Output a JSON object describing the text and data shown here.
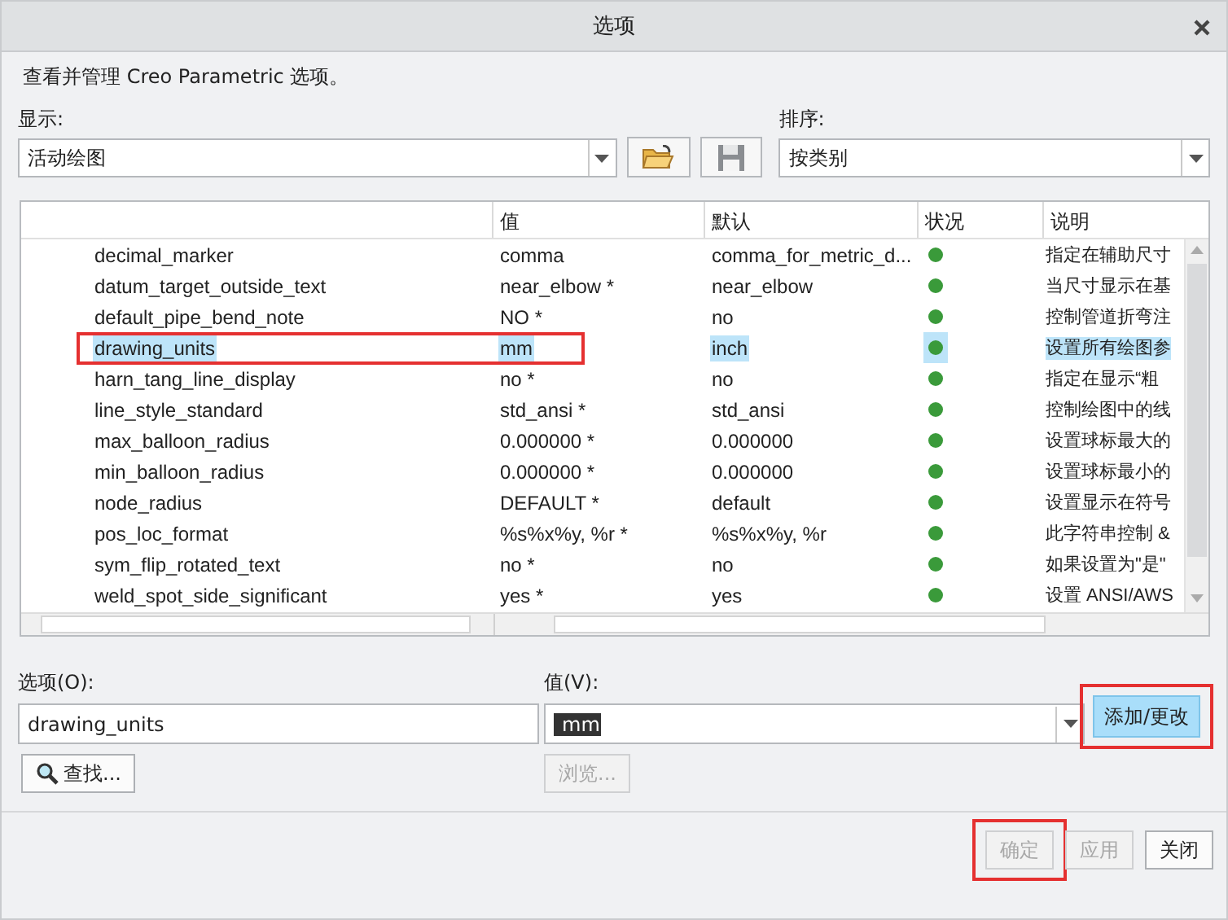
{
  "window": {
    "title": "选项"
  },
  "intro": "查看并管理 Creo Parametric 选项。",
  "show": {
    "label": "显示:",
    "value": "活动绘图"
  },
  "sort": {
    "label": "排序:",
    "value": "按类别"
  },
  "table": {
    "columns": [
      "",
      "值",
      "默认",
      "状况",
      "说明"
    ],
    "rows": [
      {
        "name": "decimal_marker",
        "value": "comma",
        "default": "comma_for_metric_d...",
        "color": "#3a9a3a",
        "description": "指定在辅助尺寸",
        "selected": false,
        "annotated": false
      },
      {
        "name": "datum_target_outside_text",
        "value": "near_elbow *",
        "default": "near_elbow",
        "color": "#3a9a3a",
        "description": "当尺寸显示在基",
        "selected": false,
        "annotated": false
      },
      {
        "name": "default_pipe_bend_note",
        "value": "NO *",
        "default": "no",
        "color": "#3a9a3a",
        "description": "控制管道折弯注",
        "selected": false,
        "annotated": false
      },
      {
        "name": "drawing_units",
        "value": "mm",
        "default": "inch",
        "color": "#3a9a3a",
        "description": "设置所有绘图参",
        "selected": true,
        "annotated": true
      },
      {
        "name": "harn_tang_line_display",
        "value": "no *",
        "default": "no",
        "color": "#3a9a3a",
        "description": "指定在显示“粗",
        "selected": false,
        "annotated": false
      },
      {
        "name": "line_style_standard",
        "value": "std_ansi *",
        "default": "std_ansi",
        "color": "#3a9a3a",
        "description": "控制绘图中的线",
        "selected": false,
        "annotated": false
      },
      {
        "name": "max_balloon_radius",
        "value": "0.000000 *",
        "default": "0.000000",
        "color": "#3a9a3a",
        "description": "设置球标最大的",
        "selected": false,
        "annotated": false
      },
      {
        "name": "min_balloon_radius",
        "value": "0.000000 *",
        "default": "0.000000",
        "color": "#3a9a3a",
        "description": "设置球标最小的",
        "selected": false,
        "annotated": false
      },
      {
        "name": "node_radius",
        "value": "DEFAULT *",
        "default": "default",
        "color": "#3a9a3a",
        "description": "设置显示在符号",
        "selected": false,
        "annotated": false
      },
      {
        "name": "pos_loc_format",
        "value": "%s%x%y, %r *",
        "default": "%s%x%y, %r",
        "color": "#3a9a3a",
        "description": "此字符串控制 &",
        "selected": false,
        "annotated": false
      },
      {
        "name": "sym_flip_rotated_text",
        "value": "no *",
        "default": "no",
        "color": "#3a9a3a",
        "description": "如果设置为\"是\"",
        "selected": false,
        "annotated": false
      },
      {
        "name": "weld_spot_side_significant",
        "value": "yes *",
        "default": "yes",
        "color": "#3a9a3a",
        "description": "设置 ANSI/AWS",
        "selected": false,
        "annotated": false
      }
    ]
  },
  "option_field": {
    "label": "选项(O):",
    "value": "drawing_units"
  },
  "value_field": {
    "label": "值(V):",
    "value": "mm"
  },
  "buttons": [
    {
      "kind": "add",
      "label": "添加/更改",
      "disabled": false,
      "annotated": true
    },
    {
      "kind": "find",
      "label": "查找...",
      "disabled": false,
      "annotated": false
    },
    {
      "kind": "browse",
      "label": "浏览...",
      "disabled": true,
      "annotated": false
    },
    {
      "kind": "ok",
      "label": "确定",
      "disabled": true,
      "annotated": true
    },
    {
      "kind": "apply",
      "label": "应用",
      "disabled": true,
      "annotated": false
    },
    {
      "kind": "close",
      "label": "关闭",
      "disabled": false,
      "annotated": false
    }
  ]
}
